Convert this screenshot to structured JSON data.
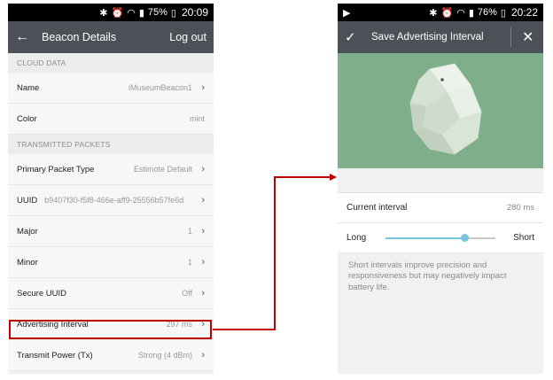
{
  "left_screen": {
    "status": {
      "battery": "75%",
      "time": "20:09"
    },
    "appbar": {
      "title": "Beacon Details",
      "action": "Log out"
    },
    "sections": {
      "cloud_data": "CLOUD DATA",
      "transmitted_packets": "TRANSMITTED PACKETS"
    },
    "rows": {
      "name": {
        "label": "Name",
        "value": "iMuseumBeacon1"
      },
      "color": {
        "label": "Color",
        "value": "mint"
      },
      "primary_packet": {
        "label": "Primary Packet Type",
        "value": "Estimote Default"
      },
      "uuid": {
        "label": "UUID",
        "value": "b9407f30-f5f8-466e-aff9-25556b57fe6d"
      },
      "major": {
        "label": "Major",
        "value": "1"
      },
      "minor": {
        "label": "Minor",
        "value": "1"
      },
      "secure_uuid": {
        "label": "Secure UUID",
        "value": "Off"
      },
      "advertising_interval": {
        "label": "Advertising Interval",
        "value": "297 ms"
      },
      "transmit_power": {
        "label": "Transmit Power (Tx)",
        "value": "Strong (4 dBm)"
      }
    }
  },
  "right_screen": {
    "status": {
      "battery": "76%",
      "time": "20:22"
    },
    "appbar": {
      "title": "Save Advertising Interval"
    },
    "current_interval": {
      "label": "Current interval",
      "value": "280 ms"
    },
    "slider": {
      "min_label": "Long",
      "max_label": "Short",
      "position": 0.72
    },
    "help_text": "Short intervals improve precision and responsiveness but may negatively impact battery life."
  },
  "colors": {
    "highlight": "#c00000",
    "hero_bg": "#7faf8a",
    "slider_accent": "#75c5dc",
    "appbar": "#4b5157"
  }
}
